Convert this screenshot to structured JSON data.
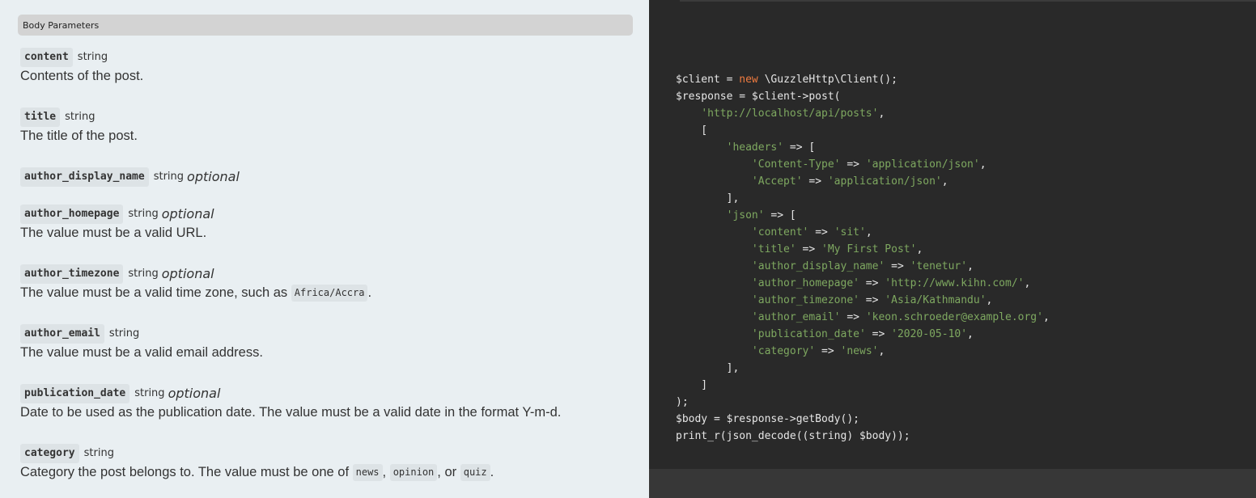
{
  "section": {
    "title": "Body Parameters"
  },
  "params": [
    {
      "name": "content",
      "type": "string",
      "optional": "",
      "desc_parts": [
        {
          "t": "text",
          "v": "Contents of the post."
        }
      ]
    },
    {
      "name": "title",
      "type": "string",
      "optional": "",
      "desc_parts": [
        {
          "t": "text",
          "v": "The title of the post."
        }
      ]
    },
    {
      "name": "author_display_name",
      "type": "string",
      "optional": "optional",
      "desc_parts": []
    },
    {
      "name": "author_homepage",
      "type": "string",
      "optional": "optional",
      "desc_parts": [
        {
          "t": "text",
          "v": "The value must be a valid URL."
        }
      ]
    },
    {
      "name": "author_timezone",
      "type": "string",
      "optional": "optional",
      "desc_parts": [
        {
          "t": "text",
          "v": "The value must be a valid time zone, such as "
        },
        {
          "t": "code",
          "v": "Africa/Accra"
        },
        {
          "t": "text",
          "v": "."
        }
      ]
    },
    {
      "name": "author_email",
      "type": "string",
      "optional": "",
      "desc_parts": [
        {
          "t": "text",
          "v": "The value must be a valid email address."
        }
      ]
    },
    {
      "name": "publication_date",
      "type": "string",
      "optional": "optional",
      "desc_parts": [
        {
          "t": "text",
          "v": "Date to be used as the publication date. The value must be a valid date in the format Y-m-d."
        }
      ]
    },
    {
      "name": "category",
      "type": "string",
      "optional": "",
      "desc_parts": [
        {
          "t": "text",
          "v": "Category the post belongs to. The value must be one of "
        },
        {
          "t": "code",
          "v": "news"
        },
        {
          "t": "text",
          "v": ", "
        },
        {
          "t": "code",
          "v": "opinion"
        },
        {
          "t": "text",
          "v": ", or "
        },
        {
          "t": "code",
          "v": "quiz"
        },
        {
          "t": "text",
          "v": "."
        }
      ]
    }
  ],
  "code_sample": {
    "language": "php",
    "lines": [
      [
        {
          "c": "var",
          "v": "$client = "
        },
        {
          "c": "kw",
          "v": "new"
        },
        {
          "c": "var",
          "v": " \\GuzzleHttp\\Client();"
        }
      ],
      [
        {
          "c": "var",
          "v": "$response = $client->post("
        }
      ],
      [
        {
          "c": "var",
          "v": "    "
        },
        {
          "c": "str",
          "v": "'http://localhost/api/posts'"
        },
        {
          "c": "var",
          "v": ","
        }
      ],
      [
        {
          "c": "var",
          "v": "    ["
        }
      ],
      [
        {
          "c": "var",
          "v": "        "
        },
        {
          "c": "str",
          "v": "'headers'"
        },
        {
          "c": "var",
          "v": " => ["
        }
      ],
      [
        {
          "c": "var",
          "v": "            "
        },
        {
          "c": "str",
          "v": "'Content-Type'"
        },
        {
          "c": "var",
          "v": " => "
        },
        {
          "c": "str",
          "v": "'application/json'"
        },
        {
          "c": "var",
          "v": ","
        }
      ],
      [
        {
          "c": "var",
          "v": "            "
        },
        {
          "c": "str",
          "v": "'Accept'"
        },
        {
          "c": "var",
          "v": " => "
        },
        {
          "c": "str",
          "v": "'application/json'"
        },
        {
          "c": "var",
          "v": ","
        }
      ],
      [
        {
          "c": "var",
          "v": "        ],"
        }
      ],
      [
        {
          "c": "var",
          "v": "        "
        },
        {
          "c": "str",
          "v": "'json'"
        },
        {
          "c": "var",
          "v": " => ["
        }
      ],
      [
        {
          "c": "var",
          "v": "            "
        },
        {
          "c": "str",
          "v": "'content'"
        },
        {
          "c": "var",
          "v": " => "
        },
        {
          "c": "str",
          "v": "'sit'"
        },
        {
          "c": "var",
          "v": ","
        }
      ],
      [
        {
          "c": "var",
          "v": "            "
        },
        {
          "c": "str",
          "v": "'title'"
        },
        {
          "c": "var",
          "v": " => "
        },
        {
          "c": "str",
          "v": "'My First Post'"
        },
        {
          "c": "var",
          "v": ","
        }
      ],
      [
        {
          "c": "var",
          "v": "            "
        },
        {
          "c": "str",
          "v": "'author_display_name'"
        },
        {
          "c": "var",
          "v": " => "
        },
        {
          "c": "str",
          "v": "'tenetur'"
        },
        {
          "c": "var",
          "v": ","
        }
      ],
      [
        {
          "c": "var",
          "v": "            "
        },
        {
          "c": "str",
          "v": "'author_homepage'"
        },
        {
          "c": "var",
          "v": " => "
        },
        {
          "c": "str",
          "v": "'http://www.kihn.com/'"
        },
        {
          "c": "var",
          "v": ","
        }
      ],
      [
        {
          "c": "var",
          "v": "            "
        },
        {
          "c": "str",
          "v": "'author_timezone'"
        },
        {
          "c": "var",
          "v": " => "
        },
        {
          "c": "str",
          "v": "'Asia/Kathmandu'"
        },
        {
          "c": "var",
          "v": ","
        }
      ],
      [
        {
          "c": "var",
          "v": "            "
        },
        {
          "c": "str",
          "v": "'author_email'"
        },
        {
          "c": "var",
          "v": " => "
        },
        {
          "c": "str",
          "v": "'keon.schroeder@example.org'"
        },
        {
          "c": "var",
          "v": ","
        }
      ],
      [
        {
          "c": "var",
          "v": "            "
        },
        {
          "c": "str",
          "v": "'publication_date'"
        },
        {
          "c": "var",
          "v": " => "
        },
        {
          "c": "str",
          "v": "'2020-05-10'"
        },
        {
          "c": "var",
          "v": ","
        }
      ],
      [
        {
          "c": "var",
          "v": "            "
        },
        {
          "c": "str",
          "v": "'category'"
        },
        {
          "c": "var",
          "v": " => "
        },
        {
          "c": "str",
          "v": "'news'"
        },
        {
          "c": "var",
          "v": ","
        }
      ],
      [
        {
          "c": "var",
          "v": "        ],"
        }
      ],
      [
        {
          "c": "var",
          "v": "    ]"
        }
      ],
      [
        {
          "c": "var",
          "v": ");"
        }
      ],
      [
        {
          "c": "var",
          "v": "$body = $response->getBody();"
        }
      ],
      [
        {
          "c": "var",
          "v": "print_r(json_decode((string) $body));"
        }
      ]
    ]
  },
  "colors": {
    "left_bg": "#e9eff2",
    "code_bg": "#292929",
    "string": "#7ea860",
    "keyword": "#f07b3f",
    "code_text": "#e6e6e6"
  }
}
